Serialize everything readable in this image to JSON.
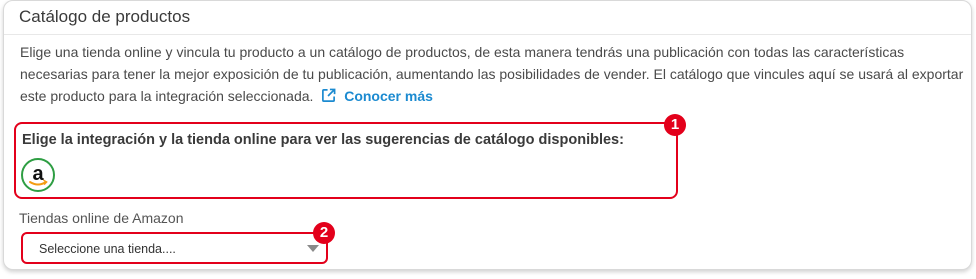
{
  "card": {
    "title": "Catálogo de productos",
    "description": "Elige una tienda online y vincula tu producto a un catálogo de productos, de esta manera tendrás una publicación con todas las características necesarias para tener la mejor exposición de tu publicación, aumentando las posibilidades de vender. El catálogo que vincules aquí se usará al exportar este producto para la integración seleccionada.",
    "learn_more_label": "Conocer más"
  },
  "integration": {
    "label": "Elige la integración y la tienda online para ver las sugerencias de catálogo disponibles:",
    "badge": "1",
    "options": [
      {
        "name": "amazon",
        "icon": "amazon-logo-icon",
        "glyph": "a"
      }
    ]
  },
  "stores": {
    "label": "Tiendas online de Amazon",
    "selected_value": "Seleccione una tienda....",
    "badge": "2"
  },
  "colors": {
    "highlight": "#e3001b",
    "link": "#1b8ad0",
    "amazon_ring": "#2e9e43",
    "amazon_smile": "#f39c12"
  }
}
